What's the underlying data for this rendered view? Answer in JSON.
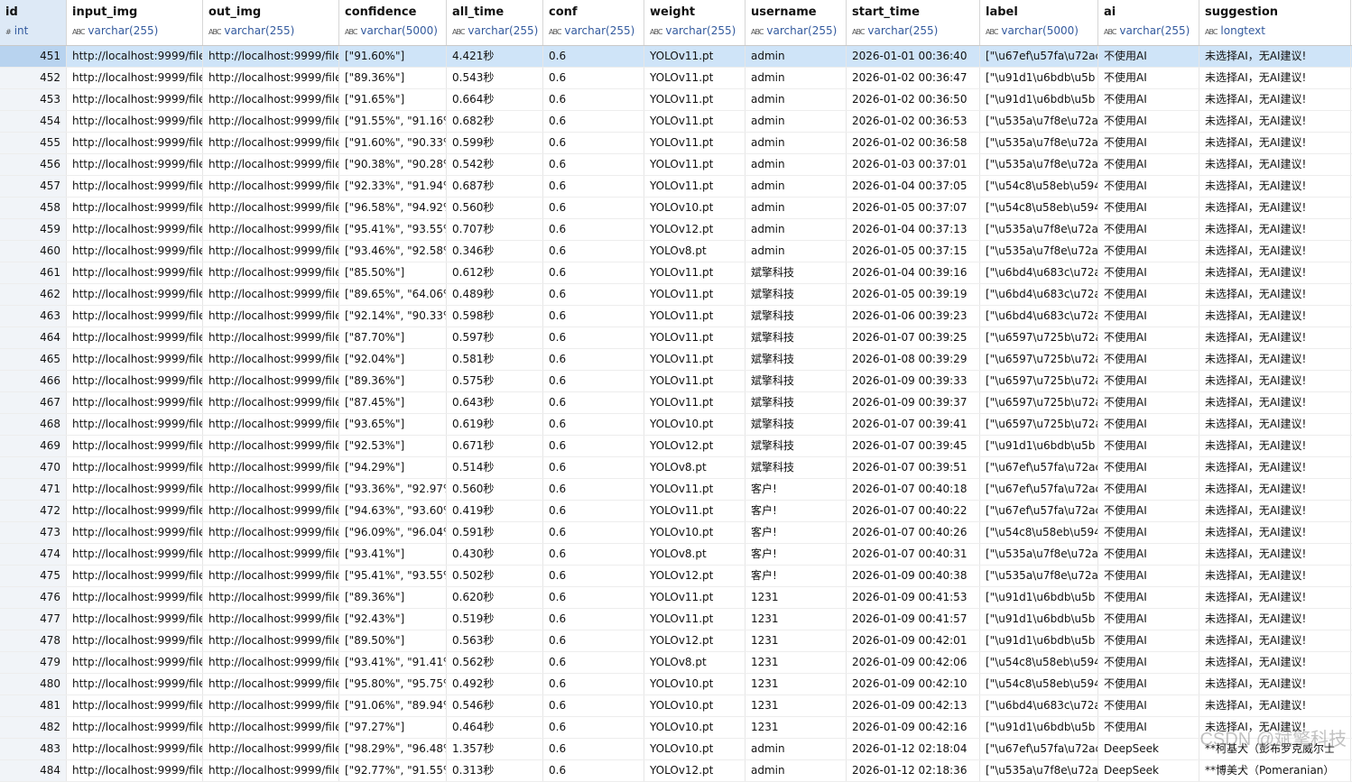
{
  "columns": [
    {
      "name": "id",
      "type": "int",
      "icon": "#"
    },
    {
      "name": "input_img",
      "type": "varchar(255)",
      "icon": "ABC"
    },
    {
      "name": "out_img",
      "type": "varchar(255)",
      "icon": "ABC"
    },
    {
      "name": "confidence",
      "type": "varchar(5000)",
      "icon": "ABC"
    },
    {
      "name": "all_time",
      "type": "varchar(255)",
      "icon": "ABC"
    },
    {
      "name": "conf",
      "type": "varchar(255)",
      "icon": "ABC"
    },
    {
      "name": "weight",
      "type": "varchar(255)",
      "icon": "ABC"
    },
    {
      "name": "username",
      "type": "varchar(255)",
      "icon": "ABC"
    },
    {
      "name": "start_time",
      "type": "varchar(255)",
      "icon": "ABC"
    },
    {
      "name": "label",
      "type": "varchar(5000)",
      "icon": "ABC"
    },
    {
      "name": "ai",
      "type": "varchar(255)",
      "icon": "ABC"
    },
    {
      "name": "suggestion",
      "type": "longtext",
      "icon": "ABC"
    }
  ],
  "rows": [
    [
      "451",
      "http://localhost:9999/file",
      "http://localhost:9999/file",
      "[\"91.60%\"]",
      "4.421秒",
      "0.6",
      "YOLOv11.pt",
      "admin",
      "2026-01-01 00:36:40",
      "[\"\\u67ef\\u57fa\\u72ac",
      "不使用AI",
      "未选择AI，无AI建议!"
    ],
    [
      "452",
      "http://localhost:9999/file",
      "http://localhost:9999/file",
      "[\"89.36%\"]",
      "0.543秒",
      "0.6",
      "YOLOv11.pt",
      "admin",
      "2026-01-02 00:36:47",
      "[\"\\u91d1\\u6bdb\\u5b",
      "不使用AI",
      "未选择AI，无AI建议!"
    ],
    [
      "453",
      "http://localhost:9999/file",
      "http://localhost:9999/file",
      "[\"91.65%\"]",
      "0.664秒",
      "0.6",
      "YOLOv11.pt",
      "admin",
      "2026-01-02 00:36:50",
      "[\"\\u91d1\\u6bdb\\u5b",
      "不使用AI",
      "未选择AI，无AI建议!"
    ],
    [
      "454",
      "http://localhost:9999/file",
      "http://localhost:9999/file",
      "[\"91.55%\", \"91.16%",
      "0.682秒",
      "0.6",
      "YOLOv11.pt",
      "admin",
      "2026-01-02 00:36:53",
      "[\"\\u535a\\u7f8e\\u72a",
      "不使用AI",
      "未选择AI，无AI建议!"
    ],
    [
      "455",
      "http://localhost:9999/file",
      "http://localhost:9999/file",
      "[\"91.60%\", \"90.33%",
      "0.599秒",
      "0.6",
      "YOLOv11.pt",
      "admin",
      "2026-01-02 00:36:58",
      "[\"\\u535a\\u7f8e\\u72a",
      "不使用AI",
      "未选择AI，无AI建议!"
    ],
    [
      "456",
      "http://localhost:9999/file",
      "http://localhost:9999/file",
      "[\"90.38%\", \"90.28%",
      "0.542秒",
      "0.6",
      "YOLOv11.pt",
      "admin",
      "2026-01-03 00:37:01",
      "[\"\\u535a\\u7f8e\\u72a",
      "不使用AI",
      "未选择AI，无AI建议!"
    ],
    [
      "457",
      "http://localhost:9999/file",
      "http://localhost:9999/file",
      "[\"92.33%\", \"91.94%",
      "0.687秒",
      "0.6",
      "YOLOv11.pt",
      "admin",
      "2026-01-04 00:37:05",
      "[\"\\u54c8\\u58eb\\u594",
      "不使用AI",
      "未选择AI，无AI建议!"
    ],
    [
      "458",
      "http://localhost:9999/file",
      "http://localhost:9999/file",
      "[\"96.58%\", \"94.92%",
      "0.560秒",
      "0.6",
      "YOLOv10.pt",
      "admin",
      "2026-01-05 00:37:07",
      "[\"\\u54c8\\u58eb\\u594",
      "不使用AI",
      "未选择AI，无AI建议!"
    ],
    [
      "459",
      "http://localhost:9999/file",
      "http://localhost:9999/file",
      "[\"95.41%\", \"93.55%",
      "0.707秒",
      "0.6",
      "YOLOv12.pt",
      "admin",
      "2026-01-04 00:37:13",
      "[\"\\u535a\\u7f8e\\u72a",
      "不使用AI",
      "未选择AI，无AI建议!"
    ],
    [
      "460",
      "http://localhost:9999/file",
      "http://localhost:9999/file",
      "[\"93.46%\", \"92.58%",
      "0.346秒",
      "0.6",
      "YOLOv8.pt",
      "admin",
      "2026-01-05 00:37:15",
      "[\"\\u535a\\u7f8e\\u72a",
      "不使用AI",
      "未选择AI，无AI建议!"
    ],
    [
      "461",
      "http://localhost:9999/file",
      "http://localhost:9999/file",
      "[\"85.50%\"]",
      "0.612秒",
      "0.6",
      "YOLOv11.pt",
      "斌擎科技",
      "2026-01-04 00:39:16",
      "[\"\\u6bd4\\u683c\\u72a",
      "不使用AI",
      "未选择AI，无AI建议!"
    ],
    [
      "462",
      "http://localhost:9999/file",
      "http://localhost:9999/file",
      "[\"89.65%\", \"64.06%",
      "0.489秒",
      "0.6",
      "YOLOv11.pt",
      "斌擎科技",
      "2026-01-05 00:39:19",
      "[\"\\u6bd4\\u683c\\u72a",
      "不使用AI",
      "未选择AI，无AI建议!"
    ],
    [
      "463",
      "http://localhost:9999/file",
      "http://localhost:9999/file",
      "[\"92.14%\", \"90.33%",
      "0.598秒",
      "0.6",
      "YOLOv11.pt",
      "斌擎科技",
      "2026-01-06 00:39:23",
      "[\"\\u6bd4\\u683c\\u72a",
      "不使用AI",
      "未选择AI，无AI建议!"
    ],
    [
      "464",
      "http://localhost:9999/file",
      "http://localhost:9999/file",
      "[\"87.70%\"]",
      "0.597秒",
      "0.6",
      "YOLOv11.pt",
      "斌擎科技",
      "2026-01-07 00:39:25",
      "[\"\\u6597\\u725b\\u72a",
      "不使用AI",
      "未选择AI，无AI建议!"
    ],
    [
      "465",
      "http://localhost:9999/file",
      "http://localhost:9999/file",
      "[\"92.04%\"]",
      "0.581秒",
      "0.6",
      "YOLOv11.pt",
      "斌擎科技",
      "2026-01-08 00:39:29",
      "[\"\\u6597\\u725b\\u72a",
      "不使用AI",
      "未选择AI，无AI建议!"
    ],
    [
      "466",
      "http://localhost:9999/file",
      "http://localhost:9999/file",
      "[\"89.36%\"]",
      "0.575秒",
      "0.6",
      "YOLOv11.pt",
      "斌擎科技",
      "2026-01-09 00:39:33",
      "[\"\\u6597\\u725b\\u72a",
      "不使用AI",
      "未选择AI，无AI建议!"
    ],
    [
      "467",
      "http://localhost:9999/file",
      "http://localhost:9999/file",
      "[\"87.45%\"]",
      "0.643秒",
      "0.6",
      "YOLOv11.pt",
      "斌擎科技",
      "2026-01-09 00:39:37",
      "[\"\\u6597\\u725b\\u72a",
      "不使用AI",
      "未选择AI，无AI建议!"
    ],
    [
      "468",
      "http://localhost:9999/file",
      "http://localhost:9999/file",
      "[\"93.65%\"]",
      "0.619秒",
      "0.6",
      "YOLOv10.pt",
      "斌擎科技",
      "2026-01-07 00:39:41",
      "[\"\\u6597\\u725b\\u72a",
      "不使用AI",
      "未选择AI，无AI建议!"
    ],
    [
      "469",
      "http://localhost:9999/file",
      "http://localhost:9999/file",
      "[\"92.53%\"]",
      "0.671秒",
      "0.6",
      "YOLOv12.pt",
      "斌擎科技",
      "2026-01-07 00:39:45",
      "[\"\\u91d1\\u6bdb\\u5b",
      "不使用AI",
      "未选择AI，无AI建议!"
    ],
    [
      "470",
      "http://localhost:9999/file",
      "http://localhost:9999/file",
      "[\"94.29%\"]",
      "0.514秒",
      "0.6",
      "YOLOv8.pt",
      "斌擎科技",
      "2026-01-07 00:39:51",
      "[\"\\u67ef\\u57fa\\u72ac",
      "不使用AI",
      "未选择AI，无AI建议!"
    ],
    [
      "471",
      "http://localhost:9999/file",
      "http://localhost:9999/file",
      "[\"93.36%\", \"92.97%",
      "0.560秒",
      "0.6",
      "YOLOv11.pt",
      "客户!",
      "2026-01-07 00:40:18",
      "[\"\\u67ef\\u57fa\\u72ac",
      "不使用AI",
      "未选择AI，无AI建议!"
    ],
    [
      "472",
      "http://localhost:9999/file",
      "http://localhost:9999/file",
      "[\"94.63%\", \"93.60%",
      "0.419秒",
      "0.6",
      "YOLOv11.pt",
      "客户!",
      "2026-01-07 00:40:22",
      "[\"\\u67ef\\u57fa\\u72ac",
      "不使用AI",
      "未选择AI，无AI建议!"
    ],
    [
      "473",
      "http://localhost:9999/file",
      "http://localhost:9999/file",
      "[\"96.09%\", \"96.04%",
      "0.591秒",
      "0.6",
      "YOLOv10.pt",
      "客户!",
      "2026-01-07 00:40:26",
      "[\"\\u54c8\\u58eb\\u594",
      "不使用AI",
      "未选择AI，无AI建议!"
    ],
    [
      "474",
      "http://localhost:9999/file",
      "http://localhost:9999/file",
      "[\"93.41%\"]",
      "0.430秒",
      "0.6",
      "YOLOv8.pt",
      "客户!",
      "2026-01-07 00:40:31",
      "[\"\\u535a\\u7f8e\\u72a",
      "不使用AI",
      "未选择AI，无AI建议!"
    ],
    [
      "475",
      "http://localhost:9999/file",
      "http://localhost:9999/file",
      "[\"95.41%\", \"93.55%",
      "0.502秒",
      "0.6",
      "YOLOv12.pt",
      "客户!",
      "2026-01-09 00:40:38",
      "[\"\\u535a\\u7f8e\\u72a",
      "不使用AI",
      "未选择AI，无AI建议!"
    ],
    [
      "476",
      "http://localhost:9999/file",
      "http://localhost:9999/file",
      "[\"89.36%\"]",
      "0.620秒",
      "0.6",
      "YOLOv11.pt",
      "1231",
      "2026-01-09 00:41:53",
      "[\"\\u91d1\\u6bdb\\u5b",
      "不使用AI",
      "未选择AI，无AI建议!"
    ],
    [
      "477",
      "http://localhost:9999/file",
      "http://localhost:9999/file",
      "[\"92.43%\"]",
      "0.519秒",
      "0.6",
      "YOLOv11.pt",
      "1231",
      "2026-01-09 00:41:57",
      "[\"\\u91d1\\u6bdb\\u5b",
      "不使用AI",
      "未选择AI，无AI建议!"
    ],
    [
      "478",
      "http://localhost:9999/file",
      "http://localhost:9999/file",
      "[\"89.50%\"]",
      "0.563秒",
      "0.6",
      "YOLOv12.pt",
      "1231",
      "2026-01-09 00:42:01",
      "[\"\\u91d1\\u6bdb\\u5b",
      "不使用AI",
      "未选择AI，无AI建议!"
    ],
    [
      "479",
      "http://localhost:9999/file",
      "http://localhost:9999/file",
      "[\"93.41%\", \"91.41%",
      "0.562秒",
      "0.6",
      "YOLOv8.pt",
      "1231",
      "2026-01-09 00:42:06",
      "[\"\\u54c8\\u58eb\\u594",
      "不使用AI",
      "未选择AI，无AI建议!"
    ],
    [
      "480",
      "http://localhost:9999/file",
      "http://localhost:9999/file",
      "[\"95.80%\", \"95.75%",
      "0.492秒",
      "0.6",
      "YOLOv10.pt",
      "1231",
      "2026-01-09 00:42:10",
      "[\"\\u54c8\\u58eb\\u594",
      "不使用AI",
      "未选择AI，无AI建议!"
    ],
    [
      "481",
      "http://localhost:9999/file",
      "http://localhost:9999/file",
      "[\"91.06%\", \"89.94%",
      "0.546秒",
      "0.6",
      "YOLOv10.pt",
      "1231",
      "2026-01-09 00:42:13",
      "[\"\\u6bd4\\u683c\\u72a",
      "不使用AI",
      "未选择AI，无AI建议!"
    ],
    [
      "482",
      "http://localhost:9999/file",
      "http://localhost:9999/file",
      "[\"97.27%\"]",
      "0.464秒",
      "0.6",
      "YOLOv10.pt",
      "1231",
      "2026-01-09 00:42:16",
      "[\"\\u91d1\\u6bdb\\u5b",
      "不使用AI",
      "未选择AI，无AI建议!"
    ],
    [
      "483",
      "http://localhost:9999/file",
      "http://localhost:9999/file",
      "[\"98.29%\", \"96.48%",
      "1.357秒",
      "0.6",
      "YOLOv10.pt",
      "admin",
      "2026-01-12 02:18:04",
      "[\"\\u67ef\\u57fa\\u72ac",
      "DeepSeek",
      "**柯基犬（彭布罗克威尔士"
    ],
    [
      "484",
      "http://localhost:9999/file",
      "http://localhost:9999/file",
      "[\"92.77%\", \"91.55%",
      "0.313秒",
      "0.6",
      "YOLOv12.pt",
      "admin",
      "2026-01-12 02:18:36",
      "[\"\\u535a\\u7f8e\\u72a",
      "DeepSeek",
      "**博美犬（Pomeranian）"
    ]
  ],
  "selected_row": 0,
  "watermark": "CSDN @斌擎科技",
  "colors": {
    "selected": "#cfe4f8",
    "id_bg": "#f1f4f8",
    "type_text": "#335a9e"
  }
}
